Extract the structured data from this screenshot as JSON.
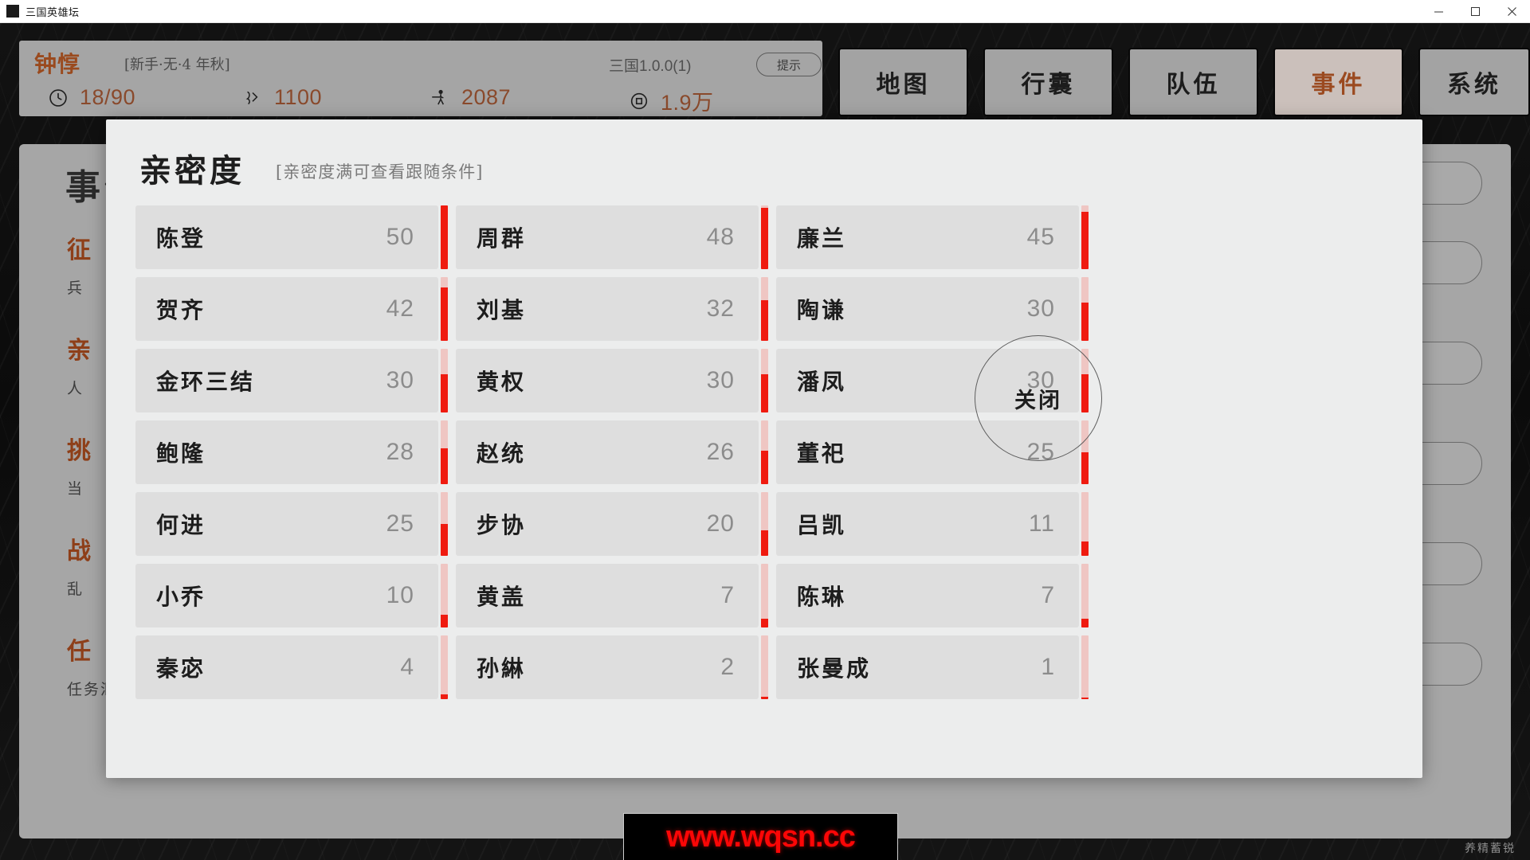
{
  "window": {
    "title": "三国英雄坛",
    "icon": "app-icon",
    "controls": {
      "minimize": "—",
      "maximize": "❐",
      "close": "✕"
    }
  },
  "hud": {
    "player_name": "钟惇",
    "status": "[新手·无·4 年秋]",
    "version": "三国1.0.0(1)",
    "tip_button": "提示",
    "stats": [
      {
        "icon": "clock-icon",
        "value": "18/90"
      },
      {
        "icon": "money-icon",
        "value": "1100"
      },
      {
        "icon": "troop-icon",
        "value": "2087"
      },
      {
        "icon": "coin-icon",
        "value": "1.9万"
      }
    ]
  },
  "nav": {
    "items": [
      {
        "label": "地图",
        "active": false
      },
      {
        "label": "行囊",
        "active": false
      },
      {
        "label": "队伍",
        "active": false
      },
      {
        "label": "事件",
        "active": true
      },
      {
        "label": "系统",
        "active": false
      }
    ]
  },
  "background_panel": {
    "title": "事件",
    "events": [
      {
        "heading": "征",
        "desc": "兵"
      },
      {
        "heading": "亲",
        "desc": "人"
      },
      {
        "heading": "挑",
        "desc": "当"
      },
      {
        "heading": "战",
        "desc": "乱"
      },
      {
        "heading": "任",
        "desc": "任务汇总"
      }
    ]
  },
  "modal": {
    "title": "亲密度",
    "hint": "[亲密度满可查看跟随条件]",
    "close_label": "关闭",
    "max_value": 50,
    "columns": [
      [
        {
          "name": "陈登",
          "value": 50
        },
        {
          "name": "贺齐",
          "value": 42
        },
        {
          "name": "金环三结",
          "value": 30
        },
        {
          "name": "鲍隆",
          "value": 28
        },
        {
          "name": "何进",
          "value": 25
        },
        {
          "name": "小乔",
          "value": 10
        },
        {
          "name": "秦宓",
          "value": 4
        }
      ],
      [
        {
          "name": "周群",
          "value": 48
        },
        {
          "name": "刘基",
          "value": 32
        },
        {
          "name": "黄权",
          "value": 30
        },
        {
          "name": "赵统",
          "value": 26
        },
        {
          "name": "步协",
          "value": 20
        },
        {
          "name": "黄盖",
          "value": 7
        },
        {
          "name": "孙綝",
          "value": 2
        }
      ],
      [
        {
          "name": "廉兰",
          "value": 45
        },
        {
          "name": "陶谦",
          "value": 30
        },
        {
          "name": "潘凤",
          "value": 30
        },
        {
          "name": "董祀",
          "value": 25
        },
        {
          "name": "吕凯",
          "value": 11
        },
        {
          "name": "陈琳",
          "value": 7
        },
        {
          "name": "张曼成",
          "value": 1
        }
      ]
    ]
  },
  "watermark": {
    "text": "www.wqsn.cc"
  },
  "corner_note": {
    "text": "养精蓄锐"
  },
  "colors": {
    "accent_orange": "#9a4a1e",
    "gauge_fill": "#ef1b10",
    "gauge_track": "#efc6c3",
    "card_bg": "#dedede",
    "modal_bg": "#eceded",
    "panel_bg": "#a6a6a6",
    "nav_active_bg": "#cbc0bb"
  }
}
